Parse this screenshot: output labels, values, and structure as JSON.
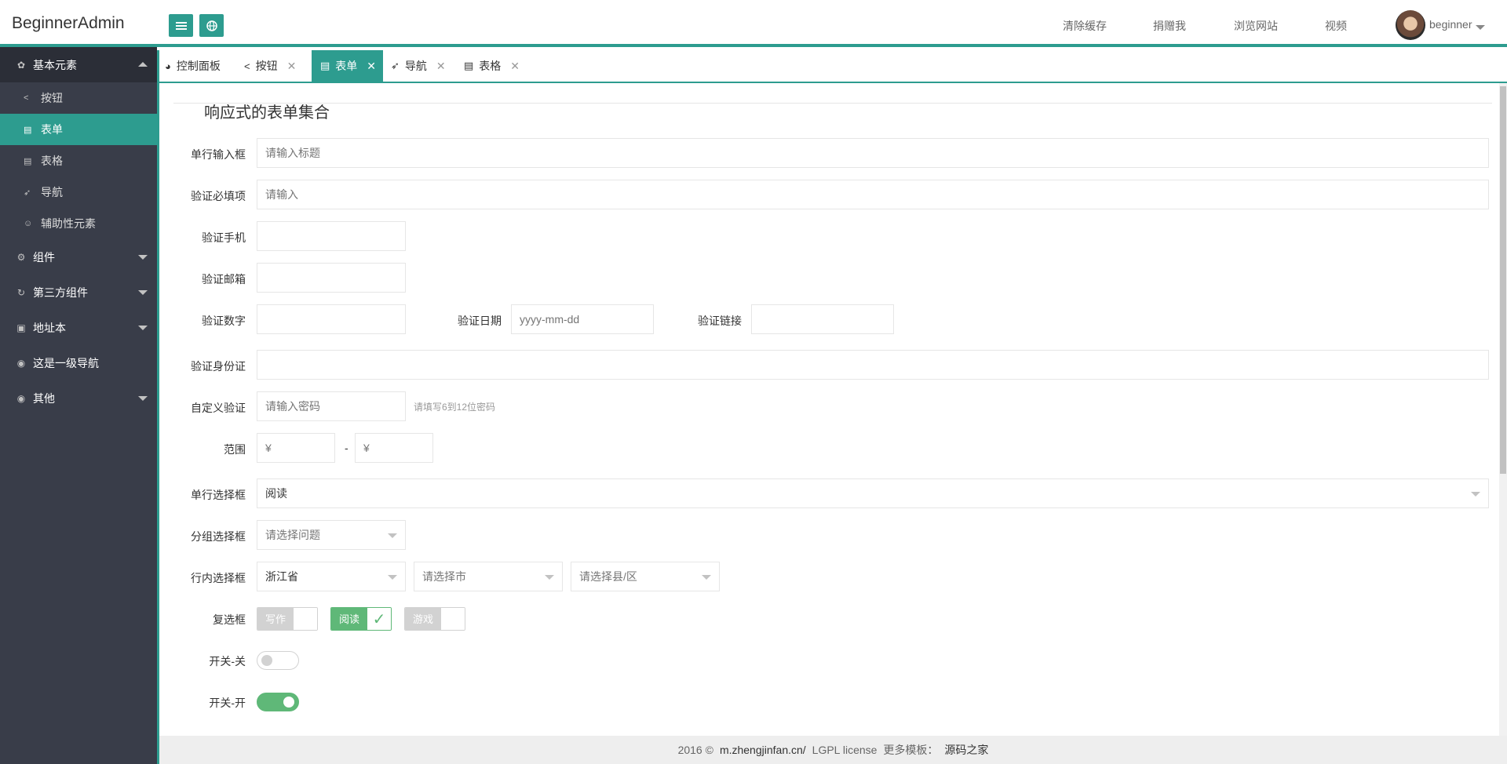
{
  "header": {
    "logo": "BeginnerAdmin",
    "nav": [
      "清除缓存",
      "捐赠我",
      "浏览网站",
      "视频"
    ],
    "username": "beginner"
  },
  "sidebar": {
    "groups": [
      {
        "label": "基本元素",
        "expanded": true,
        "items": [
          "按钮",
          "表单",
          "表格",
          "导航",
          "辅助性元素"
        ]
      },
      {
        "label": "组件",
        "expanded": false
      },
      {
        "label": "第三方组件",
        "expanded": false
      },
      {
        "label": "地址本",
        "expanded": false
      },
      {
        "label": "这是一级导航",
        "expanded": false
      },
      {
        "label": "其他",
        "expanded": false
      }
    ]
  },
  "tabs": [
    "控制面板",
    "按钮",
    "表单",
    "导航",
    "表格"
  ],
  "form": {
    "title": "响应式的表单集合",
    "labels": {
      "single": "单行输入框",
      "required": "验证必填项",
      "phone": "验证手机",
      "email": "验证邮箱",
      "number": "验证数字",
      "date": "验证日期",
      "link": "验证链接",
      "idcard": "验证身份证",
      "custom": "自定义验证",
      "range": "范围",
      "select": "单行选择框",
      "group": "分组选择框",
      "inline": "行内选择框",
      "checkbox": "复选框",
      "switch_off": "开关-关",
      "switch_on": "开关-开"
    },
    "placeholders": {
      "single": "请输入标题",
      "required": "请输入",
      "date": "yyyy-mm-dd",
      "custom": "请输入密码",
      "range_min": "¥",
      "range_max": "¥",
      "group": "请选择问题",
      "city": "请选择市",
      "county": "请选择县/区"
    },
    "custom_aux": "请填写6到12位密码",
    "range_sep": "-",
    "select_value": "阅读",
    "province_value": "浙江省",
    "checkboxes": [
      {
        "label": "写作",
        "checked": false
      },
      {
        "label": "阅读",
        "checked": true
      },
      {
        "label": "游戏",
        "checked": false
      }
    ]
  },
  "footer": {
    "copy": "2016 ©",
    "site": "m.zhengjinfan.cn/",
    "license": "LGPL license",
    "more": "更多模板：",
    "source": "源码之家"
  }
}
